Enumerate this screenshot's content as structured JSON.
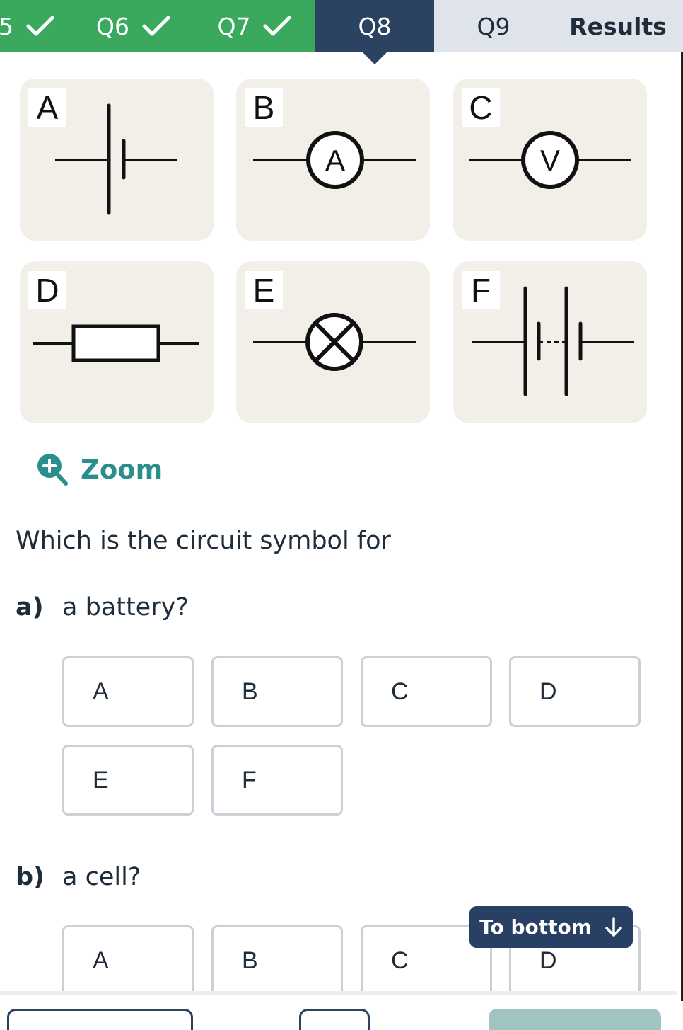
{
  "tabs": [
    {
      "label": "5",
      "status": "done"
    },
    {
      "label": "Q6",
      "status": "done"
    },
    {
      "label": "Q7",
      "status": "done"
    },
    {
      "label": "Q8",
      "status": "active"
    },
    {
      "label": "Q9",
      "status": "todo"
    },
    {
      "label": "Results",
      "status": "todo"
    }
  ],
  "symbols": [
    {
      "letter": "A",
      "icon": "cell-symbol-icon"
    },
    {
      "letter": "B",
      "icon": "ammeter-symbol-icon",
      "inner": "A"
    },
    {
      "letter": "C",
      "icon": "voltmeter-symbol-icon",
      "inner": "V"
    },
    {
      "letter": "D",
      "icon": "resistor-symbol-icon"
    },
    {
      "letter": "E",
      "icon": "lamp-symbol-icon"
    },
    {
      "letter": "F",
      "icon": "battery-symbol-icon"
    }
  ],
  "zoom": {
    "label": "Zoom",
    "icon": "zoom-in-icon"
  },
  "question": {
    "prompt": "Which is the circuit symbol for",
    "parts": [
      {
        "num": "a)",
        "text": "a battery?",
        "options": [
          "A",
          "B",
          "C",
          "D",
          "E",
          "F"
        ]
      },
      {
        "num": "b)",
        "text": "a cell?",
        "options": [
          "A",
          "B",
          "C",
          "D"
        ]
      }
    ]
  },
  "to_bottom": {
    "label": "To bottom",
    "icon": "arrow-down-icon"
  },
  "colors": {
    "done": "#3aa85d",
    "active": "#2b4261",
    "todo": "#dfe4eb",
    "accent": "#2a8f8c",
    "card": "#f2efe8"
  }
}
